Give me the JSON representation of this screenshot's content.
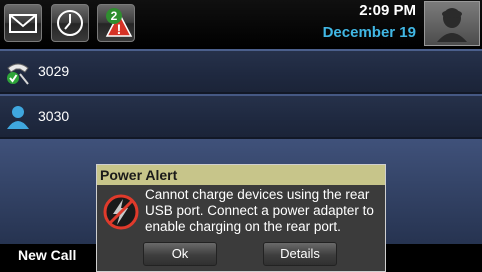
{
  "status_bar": {
    "time": "2:09 PM",
    "date": "December 19",
    "alert_count": "2",
    "icons": [
      "messages-icon",
      "clock-icon",
      "alert-icon",
      "user-avatar"
    ]
  },
  "lines": [
    {
      "number": "3029",
      "icon": "shared-line-registered-icon"
    },
    {
      "number": "3030",
      "icon": "user-line-icon"
    }
  ],
  "softkeys": {
    "new_call": "New Call"
  },
  "dialog": {
    "title": "Power Alert",
    "message": "Cannot charge devices using the rear USB port. Connect a power adapter to enable charging on the rear port.",
    "ok_label": "Ok",
    "details_label": "Details"
  },
  "colors": {
    "date_accent": "#41b7e4",
    "dialog_title_bg": "#c7c58a",
    "alert_badge": "#2f8e2f",
    "warning_red": "#e03a2b"
  }
}
